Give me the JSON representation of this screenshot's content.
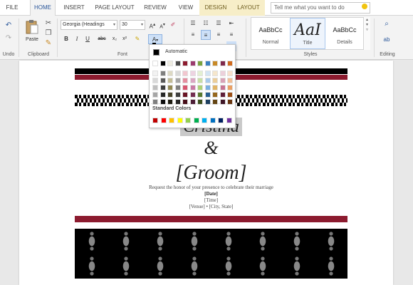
{
  "tabs": [
    {
      "label": "FILE",
      "state": "normal"
    },
    {
      "label": "HOME",
      "state": "active"
    },
    {
      "label": "INSERT",
      "state": "normal"
    },
    {
      "label": "PAGE LAYOUT",
      "state": "normal"
    },
    {
      "label": "REVIEW",
      "state": "normal"
    },
    {
      "label": "VIEW",
      "state": "normal"
    },
    {
      "label": "DESIGN",
      "state": "contextual"
    },
    {
      "label": "LAYOUT",
      "state": "contextual"
    }
  ],
  "tellme": {
    "placeholder": "Tell me what you want to do"
  },
  "ribbon": {
    "groups": {
      "undo": "Undo",
      "clipboard": "Clipboard",
      "font": "Font",
      "styles": "Styles",
      "editing": "Editing"
    },
    "paste_label": "Paste",
    "font_name": "Georgia (Headings",
    "font_size": "30",
    "grow": "A",
    "shrink": "A",
    "bold": "B",
    "italic": "I",
    "underline": "U",
    "strike": "abc",
    "subscript": "x₂",
    "superscript": "x²",
    "font_color_letter": "A",
    "styles_items": [
      {
        "sample": "AaBbCc",
        "name": "Normal"
      },
      {
        "sample": "AaI",
        "name": "Title"
      },
      {
        "sample": "AaBbCc",
        "name": "Details"
      }
    ]
  },
  "color_picker": {
    "automatic_label": "Automatic",
    "standard_label": "Standard Colors",
    "theme_columns": [
      [
        "#ffffff",
        "#f2f2f2",
        "#d9d9d9",
        "#bfbfbf",
        "#a6a6a6",
        "#7f7f7f"
      ],
      [
        "#000000",
        "#7f7f7f",
        "#595959",
        "#3f3f3f",
        "#262626",
        "#0d0d0d"
      ],
      [
        "#eeece1",
        "#ddd9c3",
        "#c4bd97",
        "#938953",
        "#494429",
        "#1d1b10"
      ],
      [
        "#4a4a4a",
        "#d9d9d9",
        "#a6a6a6",
        "#7f7f7f",
        "#3f3f3f",
        "#262626"
      ],
      [
        "#8c1b2f",
        "#f2c7cf",
        "#e58fa0",
        "#d85770",
        "#691424",
        "#460d18"
      ],
      [
        "#9b3c6e",
        "#edd3e1",
        "#dba7c3",
        "#c97ba5",
        "#742d52",
        "#4d1e36"
      ],
      [
        "#7aa33d",
        "#e3efd1",
        "#c8dfa4",
        "#acd076",
        "#5b7a2e",
        "#3d511e"
      ],
      [
        "#3a7fc1",
        "#d3e4f4",
        "#a7c9ea",
        "#7bafe0",
        "#2b5f91",
        "#1d3f60"
      ],
      [
        "#c88a27",
        "#f5e6cc",
        "#ebcd99",
        "#e1b466",
        "#96671d",
        "#644513"
      ],
      [
        "#7f2a4c",
        "#ecd0db",
        "#d9a2b7",
        "#c77493",
        "#5f1f39",
        "#3f1526"
      ],
      [
        "#d06a1d",
        "#f8dfcb",
        "#f1bf97",
        "#eaa063",
        "#9c4f16",
        "#68350f"
      ]
    ],
    "standard_colors": [
      "#c00000",
      "#ff0000",
      "#ffc000",
      "#ffff00",
      "#92d050",
      "#00b050",
      "#00b0f0",
      "#0070c0",
      "#002060",
      "#7030a0"
    ]
  },
  "document": {
    "bride": "Cristina",
    "amp": "&",
    "groom": "[Groom]",
    "request": "Request the honor of your presence to celebrate their marriage",
    "date": "[Date]",
    "time": "[Time]",
    "venue": "[Venue] • [City, State]"
  },
  "colors": {
    "accent": "#2b579a",
    "burgundy": "#8c1b2f"
  }
}
